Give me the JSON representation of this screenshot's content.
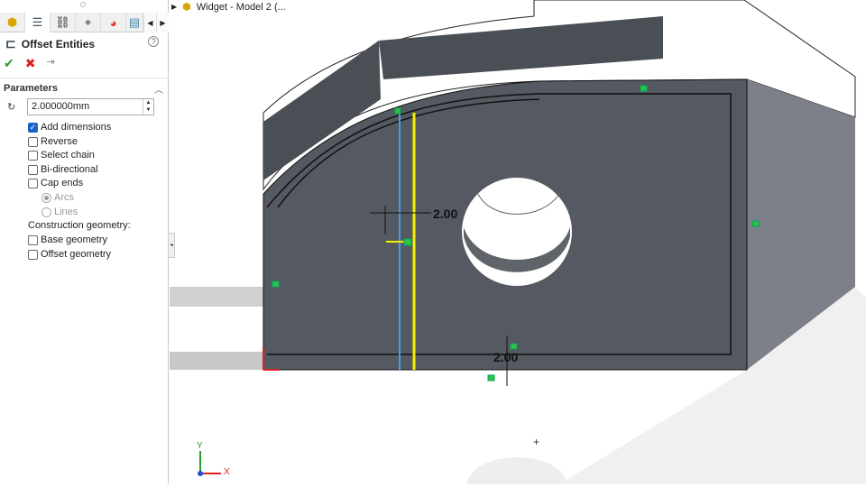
{
  "tree": {
    "model_label": "Widget - Model 2 (..."
  },
  "panel": {
    "title": "Offset Entities",
    "tabs": [
      "feature-manager",
      "property-manager",
      "configuration-manager",
      "dimxpert-manager",
      "display-manager",
      "cam-manager"
    ],
    "section": "Parameters",
    "distance": "2.000000mm",
    "options": [
      {
        "label": "Add dimensions",
        "checked": true
      },
      {
        "label": "Reverse",
        "checked": false
      },
      {
        "label": "Select chain",
        "checked": false
      },
      {
        "label": "Bi-directional",
        "checked": false
      },
      {
        "label": "Cap ends",
        "checked": false
      }
    ],
    "cap_radios": [
      {
        "label": "Arcs",
        "selected": true
      },
      {
        "label": "Lines",
        "selected": false
      }
    ],
    "construction_label": "Construction geometry:",
    "construction": [
      {
        "label": "Base geometry",
        "checked": false
      },
      {
        "label": "Offset geometry",
        "checked": false
      }
    ]
  },
  "viewport": {
    "dim_horizontal": "2.00",
    "dim_vertical": "2.00",
    "axis_y": "Y",
    "axis_x": "X"
  }
}
